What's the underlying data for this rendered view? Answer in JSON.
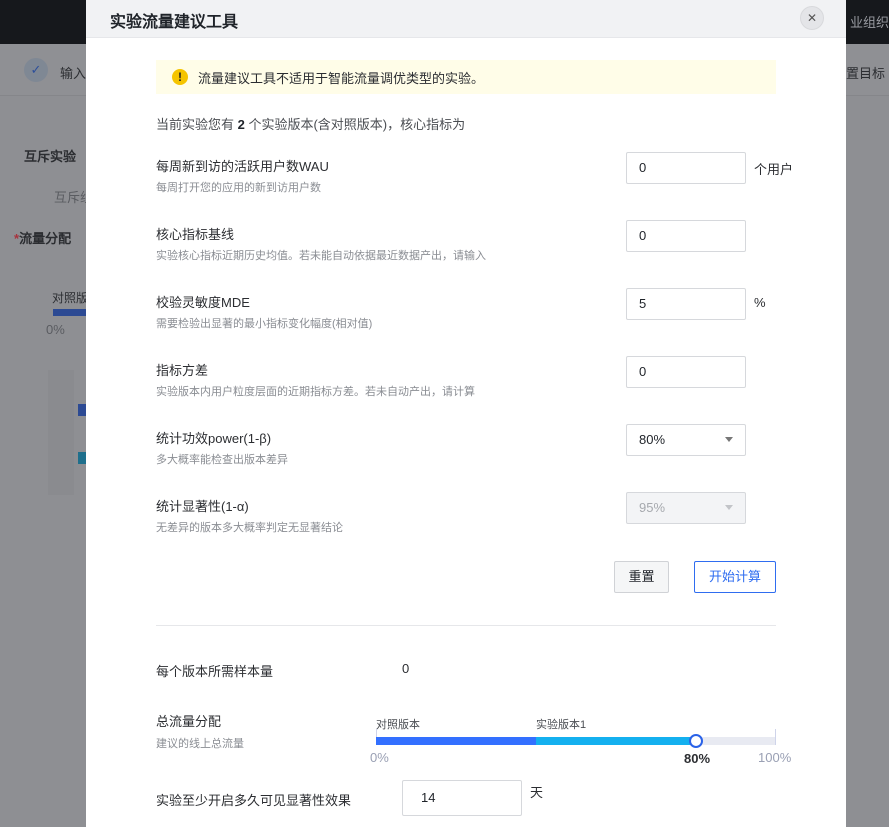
{
  "background": {
    "org_text": "业组织",
    "step_label": "输入",
    "step_right": "置目标",
    "section_title": "互斥实验",
    "mutex_label": "互斥组",
    "traffic_label": "流量分配",
    "required_mark": "*",
    "control_label": "对照版",
    "zero_pct": "0%"
  },
  "modal": {
    "title": "实验流量建议工具",
    "close_icon": "close-icon",
    "warning": "流量建议工具不适用于智能流量调优类型的实验。",
    "intro_prefix": "当前实验您有 ",
    "intro_count": "2",
    "intro_suffix": " 个实验版本(含对照版本)，核心指标为",
    "fields": [
      {
        "label": "每周新到访的活跃用户数WAU",
        "hint": "每周打开您的应用的新到访用户数",
        "value": "0",
        "unit": "个用户"
      },
      {
        "label": "核心指标基线",
        "hint": "实验核心指标近期历史均值。若未能自动依据最近数据产出，请输入",
        "value": "0"
      },
      {
        "label": "校验灵敏度MDE",
        "hint": "需要检验出显著的最小指标变化幅度(相对值)",
        "value": "5",
        "unit": "%"
      },
      {
        "label": "指标方差",
        "hint": "实验版本内用户粒度层面的近期指标方差。若未自动产出，请计算",
        "value": "0"
      },
      {
        "label": "统计功效power(1-β)",
        "hint": "多大概率能检查出版本差异",
        "value": "80%"
      },
      {
        "label": "统计显著性(1-α)",
        "hint": "无差异的版本多大概率判定无显著结论",
        "value": "95%"
      }
    ],
    "reset_label": "重置",
    "calc_label": "开始计算",
    "results": {
      "sample_label": "每个版本所需样本量",
      "sample_value": "0",
      "traffic_label": "总流量分配",
      "traffic_hint": "建议的线上总流量",
      "control_version": "对照版本",
      "exp_version": "实验版本1",
      "traffic_percent": 80,
      "control_percent": 40,
      "min_label": "0%",
      "value_label": "80%",
      "max_label": "100%",
      "days_label": "实验至少开启多久可见显著性效果",
      "days_value": "14",
      "days_unit": "天"
    },
    "colors": {
      "control": "#3370ff",
      "experiment": "#14b0ef",
      "accent": "#2f6df0"
    }
  }
}
